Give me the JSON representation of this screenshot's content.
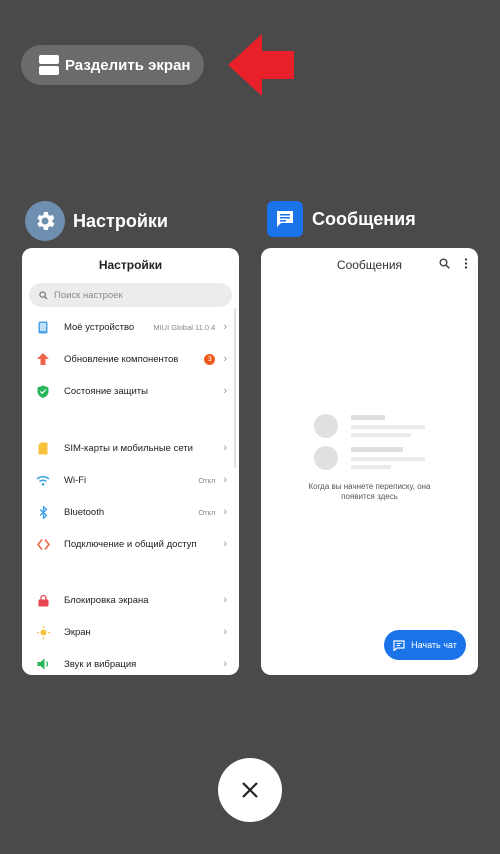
{
  "split_button": {
    "label": "Разделить экран",
    "icon": "split-screen-icon"
  },
  "arrow": {
    "color": "#e8202a"
  },
  "apps": {
    "settings": {
      "name": "Настройки",
      "card_title": "Настройки",
      "search_placeholder": "Поиск настроек",
      "rows": [
        {
          "label": "Моё устройство",
          "value": "MIUI Global 11.0.4",
          "icon": "phone-icon"
        },
        {
          "label": "Обновление компонентов",
          "badge": "3",
          "icon": "update-arrow-icon"
        },
        {
          "label": "Состояние защиты",
          "icon": "shield-check-icon"
        },
        {
          "label": "SIM-карты и мобильные сети",
          "icon": "sim-card-icon"
        },
        {
          "label": "Wi-Fi",
          "value": "Откл",
          "icon": "wifi-icon"
        },
        {
          "label": "Bluetooth",
          "value": "Откл",
          "icon": "bluetooth-icon"
        },
        {
          "label": "Подключение и общий доступ",
          "icon": "connection-icon"
        },
        {
          "label": "Блокировка экрана",
          "icon": "lock-icon"
        },
        {
          "label": "Экран",
          "icon": "brightness-icon"
        },
        {
          "label": "Звук и вибрация",
          "icon": "sound-icon"
        }
      ]
    },
    "messages": {
      "name": "Сообщения",
      "card_title": "Сообщения",
      "empty_text_line1": "Когда вы начнете переписку, она",
      "empty_text_line2": "появится здесь",
      "fab_label": "Начать чат"
    }
  },
  "close_button": {
    "icon": "close-icon"
  }
}
